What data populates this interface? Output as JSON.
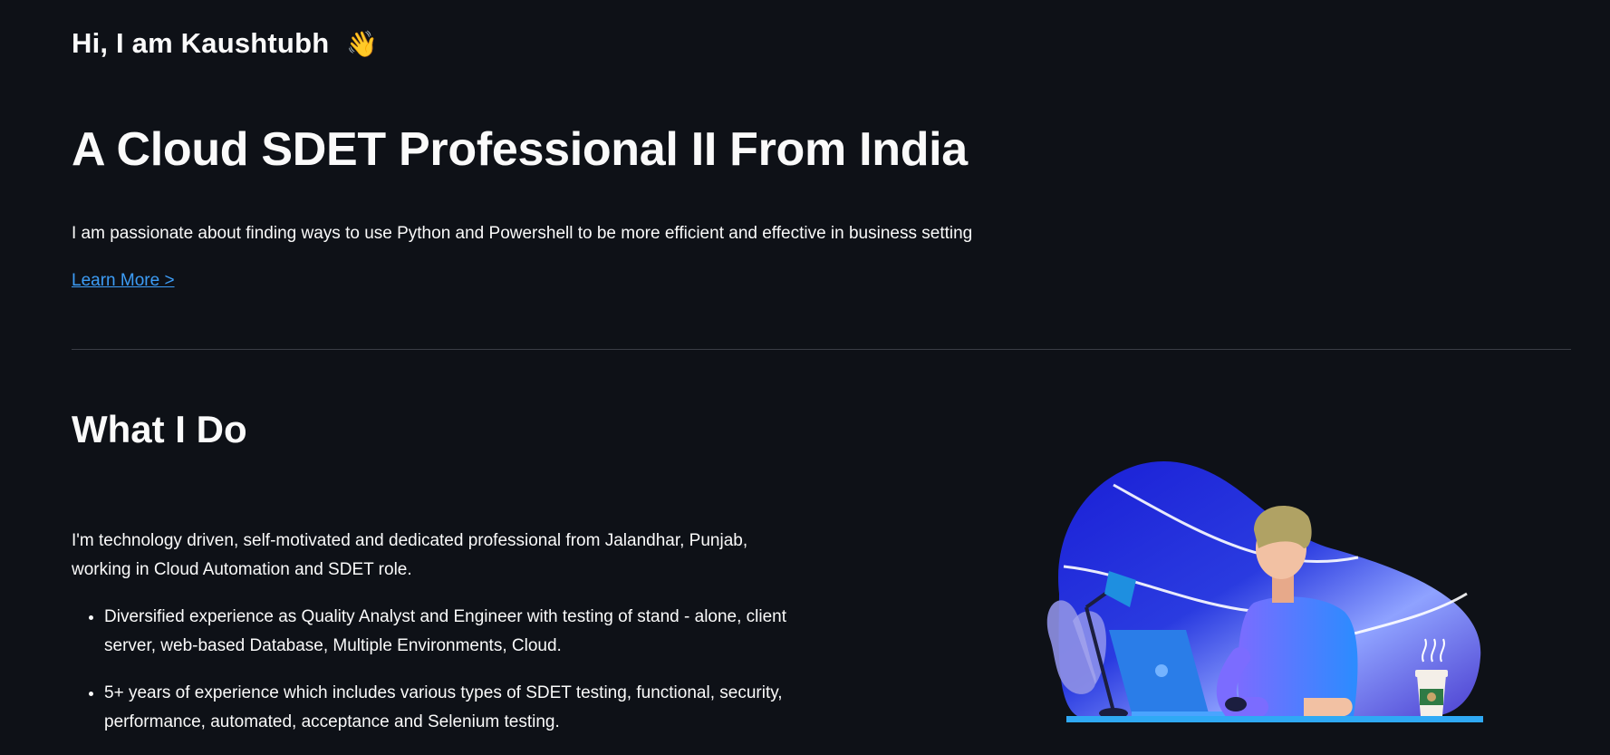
{
  "header": {
    "greeting": "Hi, I am Kaushtubh",
    "wave_emoji": "👋"
  },
  "hero": {
    "headline": "A Cloud SDET Professional II From India",
    "intro": "I am passionate about finding ways to use Python and Powershell to be more efficient and effective in business setting",
    "learn_more_label": "Learn More >"
  },
  "what_i_do": {
    "title": "What I Do",
    "about": "I'm technology driven, self-motivated and dedicated professional from Jalandhar, Punjab, working in Cloud Automation and SDET role.",
    "bullets": [
      "Diversified experience as Quality Analyst and Engineer with testing of stand - alone, client server, web-based Database, Multiple Environments, Cloud.",
      "5+ years of experience which includes various types of SDET testing, functional, security, performance, automated, acceptance and Selenium testing."
    ],
    "illustration_icon": "developer-at-laptop-illustration"
  },
  "colors": {
    "background": "#0e1117",
    "text": "#fafafa",
    "link": "#3d9df6",
    "divider": "#3a3d45"
  }
}
